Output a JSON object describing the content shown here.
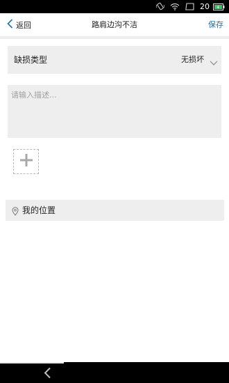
{
  "status_bar": {
    "time": "20",
    "icons": [
      "vibrate-icon",
      "wifi-icon",
      "recents-icon",
      "battery-icon"
    ]
  },
  "nav": {
    "back_label": "返回",
    "title": "路肩边沟不洁",
    "save_label": "保存"
  },
  "form": {
    "damage_type": {
      "label": "缺损类型",
      "value": "无损坏"
    },
    "description": {
      "placeholder": "请输入描述...",
      "value": ""
    },
    "add_photo_icon": "plus-icon",
    "location": {
      "label": "我的位置",
      "icon": "location-pin-icon"
    }
  },
  "colors": {
    "accent": "#1f6fae",
    "field_background": "#eeeeee",
    "status_bar": "#000000",
    "battery": "#3cc46a"
  }
}
